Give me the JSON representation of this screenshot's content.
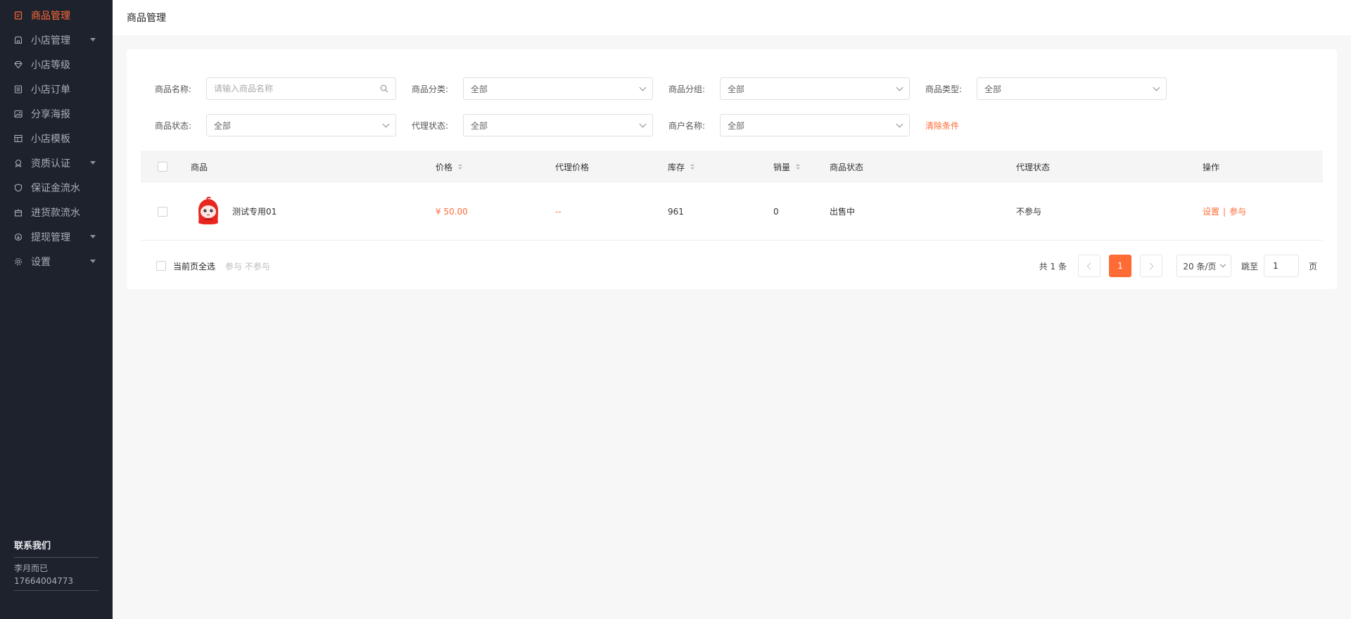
{
  "sidebar": {
    "items": [
      {
        "label": "商品管理",
        "icon": "clipboard-icon",
        "active": true,
        "expandable": false
      },
      {
        "label": "小店管理",
        "icon": "shop-icon",
        "active": false,
        "expandable": true
      },
      {
        "label": "小店等级",
        "icon": "diamond-icon",
        "active": false,
        "expandable": false
      },
      {
        "label": "小店订单",
        "icon": "list-icon",
        "active": false,
        "expandable": false
      },
      {
        "label": "分享海报",
        "icon": "image-icon",
        "active": false,
        "expandable": false
      },
      {
        "label": "小店模板",
        "icon": "template-icon",
        "active": false,
        "expandable": false
      },
      {
        "label": "资质认证",
        "icon": "badge-icon",
        "active": false,
        "expandable": true
      },
      {
        "label": "保证金流水",
        "icon": "shield-icon",
        "active": false,
        "expandable": false
      },
      {
        "label": "进货款流水",
        "icon": "box-icon",
        "active": false,
        "expandable": false
      },
      {
        "label": "提现管理",
        "icon": "withdraw-icon",
        "active": false,
        "expandable": true
      },
      {
        "label": "设置",
        "icon": "gear-icon",
        "active": false,
        "expandable": true
      }
    ],
    "contact": {
      "title": "联系我们",
      "name": "李月而已",
      "phone": "17664004773"
    }
  },
  "header": {
    "title": "商品管理"
  },
  "filters": {
    "name_label": "商品名称:",
    "name_placeholder": "请输入商品名称",
    "category_label": "商品分类:",
    "category_value": "全部",
    "group_label": "商品分组:",
    "group_value": "全部",
    "type_label": "商品类型:",
    "type_value": "全部",
    "status_label": "商品状态:",
    "status_value": "全部",
    "agent_label": "代理状态:",
    "agent_value": "全部",
    "merchant_label": "商户名称:",
    "merchant_value": "全部",
    "clear_label": "清除条件"
  },
  "table": {
    "columns": {
      "product": "商品",
      "price": "价格",
      "agent_price": "代理价格",
      "stock": "库存",
      "sales": "销量",
      "status": "商品状态",
      "agent_status": "代理状态",
      "actions": "操作"
    },
    "rows": [
      {
        "name": "测试专用01",
        "price": "¥ 50.00",
        "agent_price": "--",
        "stock": "961",
        "sales": "0",
        "status": "出售中",
        "agent_status": "不参与",
        "action_set": "设置",
        "action_sep": "|",
        "action_join": "参与"
      }
    ]
  },
  "footer": {
    "select_all_label": "当前页全选",
    "bulk_actions": "参与 不参与",
    "total": "共 1 条",
    "current_page": "1",
    "page_size": "20 条/页",
    "jump_label": "跳至",
    "jump_value": "1",
    "page_suffix": "页"
  },
  "colors": {
    "accent": "#ff6b35",
    "sidebar_bg": "#1e222d"
  }
}
